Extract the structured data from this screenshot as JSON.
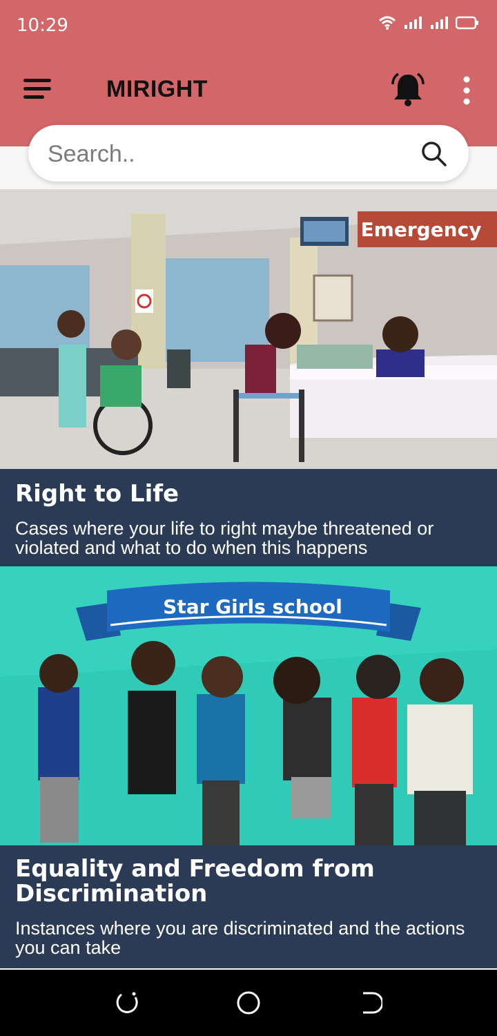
{
  "status": {
    "time": "10:29"
  },
  "appbar": {
    "title": "MIRIGHT"
  },
  "search": {
    "placeholder": "Search.."
  },
  "cards": [
    {
      "title": "Right to Life",
      "description": "Cases where your life to right maybe threatened or violated and what to do when this happens",
      "image_sign": "Emergency"
    },
    {
      "title": "Equality and Freedom from Discrimination",
      "description": "Instances where you are discriminated and the actions you can take",
      "image_banner": "Star Girls school"
    }
  ],
  "colors": {
    "accent": "#d36668",
    "caption_bg": "#2b3a55",
    "teal": "#2fcbb7"
  }
}
